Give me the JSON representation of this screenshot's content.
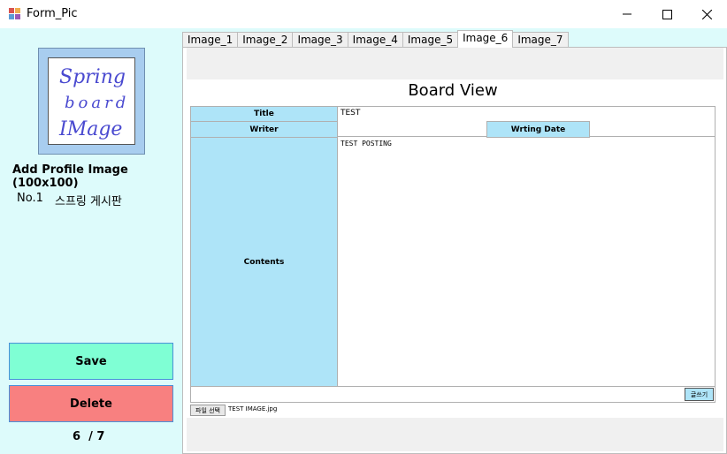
{
  "window": {
    "title": "Form_Pic"
  },
  "profile": {
    "image_text": [
      "Spring",
      "board",
      "IMage"
    ],
    "add_label": "Add Profile Image (100x100)",
    "number_label": "No.1",
    "board_name": "스프링 게시판"
  },
  "buttons": {
    "save": "Save",
    "delete": "Delete"
  },
  "pager": {
    "text": "6  / 7"
  },
  "tabs": [
    "Image_1",
    "Image_2",
    "Image_3",
    "Image_4",
    "Image_5",
    "Image_6",
    "Image_7"
  ],
  "active_tab": "Image_6",
  "board": {
    "heading": "Board View",
    "title_label": "Title",
    "title_value": "TEST",
    "writer_label": "Writer",
    "writer_value": "",
    "date_label": "Wrting Date",
    "date_value": "",
    "contents_label": "Contents",
    "contents_value": "TEST POSTING",
    "write_button": "글쓰기",
    "file_button": "파일 선택",
    "file_name": "TEST IMAGE.jpg"
  },
  "colors": {
    "pane_bg": "#ddfbfb",
    "header_cell": "#aee4f8",
    "save_button": "#7fffd4",
    "delete_button": "#f88080",
    "profile_frame": "#a8cdef",
    "handwriting": "#4a4ad0"
  },
  "icons": {
    "app": "form-app-icon",
    "minimize": "minimize-icon",
    "maximize": "maximize-icon",
    "close": "close-icon"
  }
}
